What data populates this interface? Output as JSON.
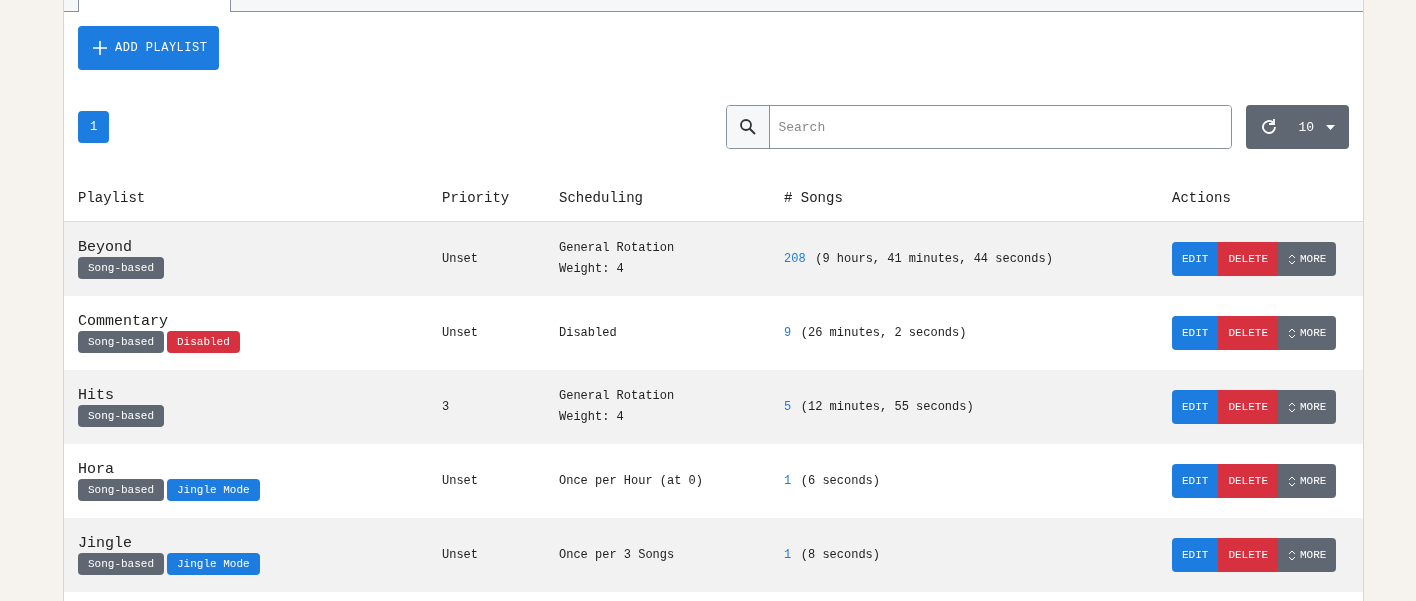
{
  "add_button": "ADD PLAYLIST",
  "pagination": [
    {
      "label": "1",
      "selected": true
    }
  ],
  "search": {
    "placeholder": "Search"
  },
  "page_size": "10",
  "table": {
    "columns": [
      "Playlist",
      "Priority",
      "Scheduling",
      "# Songs",
      "Actions"
    ],
    "rows": [
      {
        "name": "Beyond",
        "badges": [
          {
            "label": "Song-based",
            "kind": "type"
          }
        ],
        "priority": "Unset",
        "scheduling": [
          "General Rotation",
          "Weight: 4"
        ],
        "song_count": "208",
        "duration": "(9 hours, 41 minutes, 44 seconds)",
        "actions": [
          "EDIT",
          "DELETE",
          "MORE"
        ]
      },
      {
        "name": "Commentary",
        "badges": [
          {
            "label": "Song-based",
            "kind": "type"
          },
          {
            "label": "Disabled",
            "kind": "disabled"
          }
        ],
        "priority": "Unset",
        "scheduling": [
          "Disabled"
        ],
        "song_count": "9",
        "duration": "(26 minutes, 2 seconds)",
        "actions": [
          "EDIT",
          "DELETE",
          "MORE"
        ]
      },
      {
        "name": "Hits",
        "badges": [
          {
            "label": "Song-based",
            "kind": "type"
          }
        ],
        "priority": "3",
        "scheduling": [
          "General Rotation",
          "Weight: 4"
        ],
        "song_count": "5",
        "duration": "(12 minutes, 55 seconds)",
        "actions": [
          "EDIT",
          "DELETE",
          "MORE"
        ]
      },
      {
        "name": "Hora",
        "badges": [
          {
            "label": "Song-based",
            "kind": "type"
          },
          {
            "label": "Jingle Mode",
            "kind": "mode"
          }
        ],
        "priority": "Unset",
        "scheduling": [
          "Once per Hour (at 0)"
        ],
        "song_count": "1",
        "duration": "(6 seconds)",
        "actions": [
          "EDIT",
          "DELETE",
          "MORE"
        ]
      },
      {
        "name": "Jingle",
        "badges": [
          {
            "label": "Song-based",
            "kind": "type"
          },
          {
            "label": "Jingle Mode",
            "kind": "mode"
          }
        ],
        "priority": "Unset",
        "scheduling": [
          "Once per 3 Songs"
        ],
        "song_count": "1",
        "duration": "(8 seconds)",
        "actions": [
          "EDIT",
          "DELETE",
          "MORE"
        ]
      }
    ]
  }
}
